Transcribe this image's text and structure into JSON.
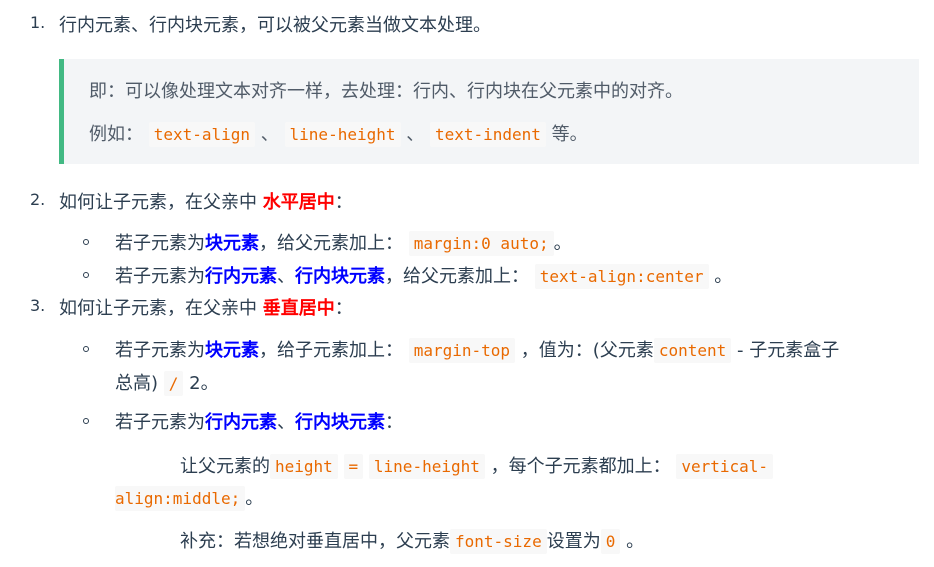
{
  "items": [
    {
      "number": "1.",
      "text": "行内元素、行内块元素，可以被父元素当做文本处理。",
      "tip": {
        "line1": "即：可以像处理文本对齐一样，去处理：行内、行内块在父元素中的对齐。",
        "line2_prefix": "例如：",
        "code1": "text-align",
        "sep1": "、",
        "code2": "line-height",
        "sep2": "、",
        "code3": "text-indent",
        "suffix": "等。"
      }
    },
    {
      "number": "2.",
      "prefix": "如何让子元素，在父亲中",
      "highlight": "水平居中",
      "suffix": "：",
      "bullets": [
        {
          "prefix": "若子元素为",
          "strong": "块元素",
          "mid": "，给父元素加上：",
          "code": "margin:0 auto;",
          "end": "。"
        },
        {
          "prefix": "若子元素为",
          "strong1": "行内元素",
          "sep": "、",
          "strong2": "行内块元素",
          "mid": "，给父元素加上：",
          "code": "text-align:center",
          "end": "。"
        }
      ]
    },
    {
      "number": "3.",
      "prefix": "如何让子元素，在父亲中",
      "highlight": "垂直居中",
      "suffix": "：",
      "bullets": [
        {
          "prefix": "若子元素为",
          "strong": "块元素",
          "mid": "，给子元素加上：",
          "code1": "margin-top",
          "mid2": "，值为：(父元素",
          "code2": "content",
          "mid3": "- 子元素盒子",
          "line2_a": "总高)",
          "code3": "/",
          "line2_b": "2。"
        },
        {
          "prefix": "若子元素为",
          "strong1": "行内元素",
          "sep": "、",
          "strong2": "行内块元素",
          "suffix": "：",
          "para1_a": "让父元素的",
          "para1_code1": "height",
          "para1_eq": "=",
          "para1_code2": "line-height",
          "para1_mid": "，每个子元素都加上：",
          "para1_code3a": "vertical-",
          "para1_code3b": "align:middle;",
          "para1_end": "。",
          "para2_a": "补充：若想绝对垂直居中，父元素",
          "para2_code1": "font-size",
          "para2_mid": "设置为",
          "para2_code2": "0",
          "para2_end": "。"
        }
      ]
    }
  ]
}
